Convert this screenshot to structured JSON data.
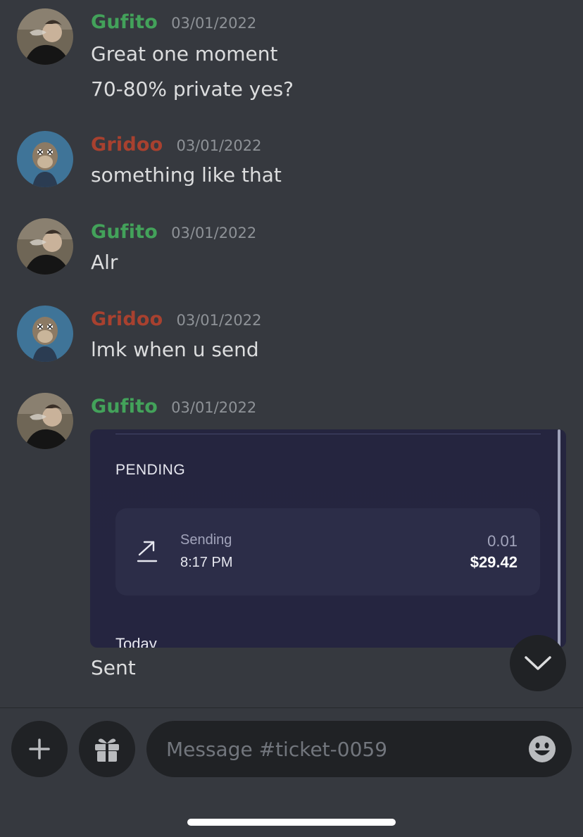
{
  "messages": [
    {
      "author": "Gufito",
      "author_color": "#43a25a",
      "timestamp": "03/01/2022",
      "lines": [
        "Great one moment",
        "70-80% private yes?"
      ]
    },
    {
      "author": "Gridoo",
      "author_color": "#a8412f",
      "timestamp": "03/01/2022",
      "lines": [
        "something like that"
      ]
    },
    {
      "author": "Gufito",
      "author_color": "#43a25a",
      "timestamp": "03/01/2022",
      "lines": [
        "Alr"
      ]
    },
    {
      "author": "Gridoo",
      "author_color": "#a8412f",
      "timestamp": "03/01/2022",
      "lines": [
        "lmk when u send"
      ]
    },
    {
      "author": "Gufito",
      "author_color": "#43a25a",
      "timestamp": "03/01/2022",
      "lines": [
        "Sent"
      ]
    }
  ],
  "attachment": {
    "section_label": "PENDING",
    "transaction": {
      "direction_label": "Sending",
      "time": "8:17 PM",
      "amount": "0.01",
      "usd_value": "$29.42",
      "icon": "arrow-up-right-icon"
    },
    "next_section_label": "Today"
  },
  "composer": {
    "add_icon": "plus-icon",
    "gift_icon": "gift-icon",
    "placeholder": "Message #ticket-0059",
    "emoji_icon": "smiley-icon"
  },
  "scroll_button_icon": "chevron-down-icon",
  "colors": {
    "background": "#36393f",
    "input_background": "#202225",
    "text": "#dcddde",
    "timestamp": "#8e9297"
  }
}
